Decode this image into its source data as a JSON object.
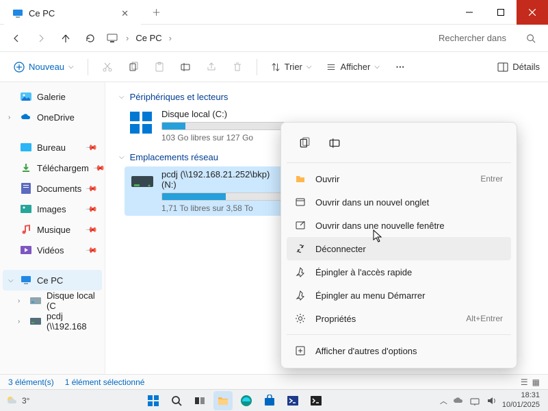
{
  "titlebar": {
    "tab_title": "Ce PC"
  },
  "nav": {
    "breadcrumb": "Ce PC",
    "search_placeholder": "Rechercher dans"
  },
  "toolbar": {
    "new_label": "Nouveau",
    "sort_label": "Trier",
    "view_label": "Afficher",
    "details_label": "Détails"
  },
  "sidebar": {
    "gallery": "Galerie",
    "onedrive": "OneDrive",
    "desktop": "Bureau",
    "downloads": "Téléchargem",
    "documents": "Documents",
    "images": "Images",
    "music": "Musique",
    "videos": "Vidéos",
    "this_pc": "Ce PC",
    "local_disk": "Disque local (C",
    "network_drive": "pcdj (\\\\192.168"
  },
  "main": {
    "group_devices": "Périphériques et lecteurs",
    "group_network": "Emplacements réseau",
    "drive_c": {
      "name": "Disque local (C:)",
      "free": "103 Go libres sur 127 Go",
      "fill_pct": 19
    },
    "drive_n": {
      "name": "pcdj (\\\\192.168.21.252\\bkp) (N:)",
      "free": "1,71 To libres sur 3,58 To",
      "fill_pct": 52
    }
  },
  "context": {
    "open": "Ouvrir",
    "open_sc": "Entrer",
    "open_tab": "Ouvrir dans un nouvel onglet",
    "open_win": "Ouvrir dans une nouvelle fenêtre",
    "disconnect": "Déconnecter",
    "pin_quick": "Épingler à l'accès rapide",
    "pin_start": "Épingler au menu Démarrer",
    "properties": "Propriétés",
    "properties_sc": "Alt+Entrer",
    "more": "Afficher d'autres d'options"
  },
  "statusbar": {
    "count": "3 élément(s)",
    "selected": "1 élément sélectionné"
  },
  "taskbar": {
    "temp": "3°",
    "time": "18:31",
    "date": "10/01/2025"
  }
}
